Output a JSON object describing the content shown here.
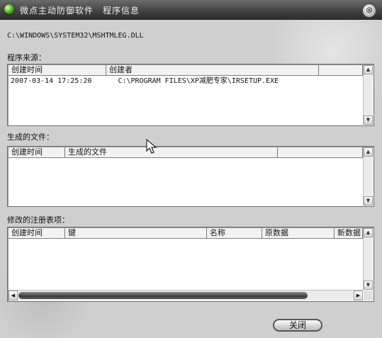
{
  "window": {
    "title": "微点主动防御软件　程序信息",
    "close_glyph": "⊗"
  },
  "program_path": "C:\\WINDOWS\\SYSTEM32\\MSHTMLEG.DLL",
  "source": {
    "label": "程序来源：",
    "columns": [
      "创建时间",
      "创建者"
    ],
    "rows": [
      {
        "time": "2007-03-14 17:25:20",
        "creator": "C:\\PROGRAM FILES\\XP减肥专家\\IRSETUP.EXE"
      }
    ]
  },
  "generated": {
    "label": "生成的文件：",
    "columns": [
      "创建时间",
      "生成的文件"
    ],
    "rows": []
  },
  "registry": {
    "label": "修改的注册表项：",
    "columns": [
      "创建时间",
      "键",
      "名称",
      "原数据",
      "新数据"
    ],
    "rows": []
  },
  "buttons": {
    "close": "关闭"
  },
  "icons": {
    "title_orb": "green-orb-icon",
    "close": "close-circle-icon",
    "cursor": "mouse-pointer-icon"
  },
  "colors": {
    "titlebar": "#3f3f3f",
    "window_bg": "#cfcfcf",
    "title_orb": "#3aa400"
  }
}
